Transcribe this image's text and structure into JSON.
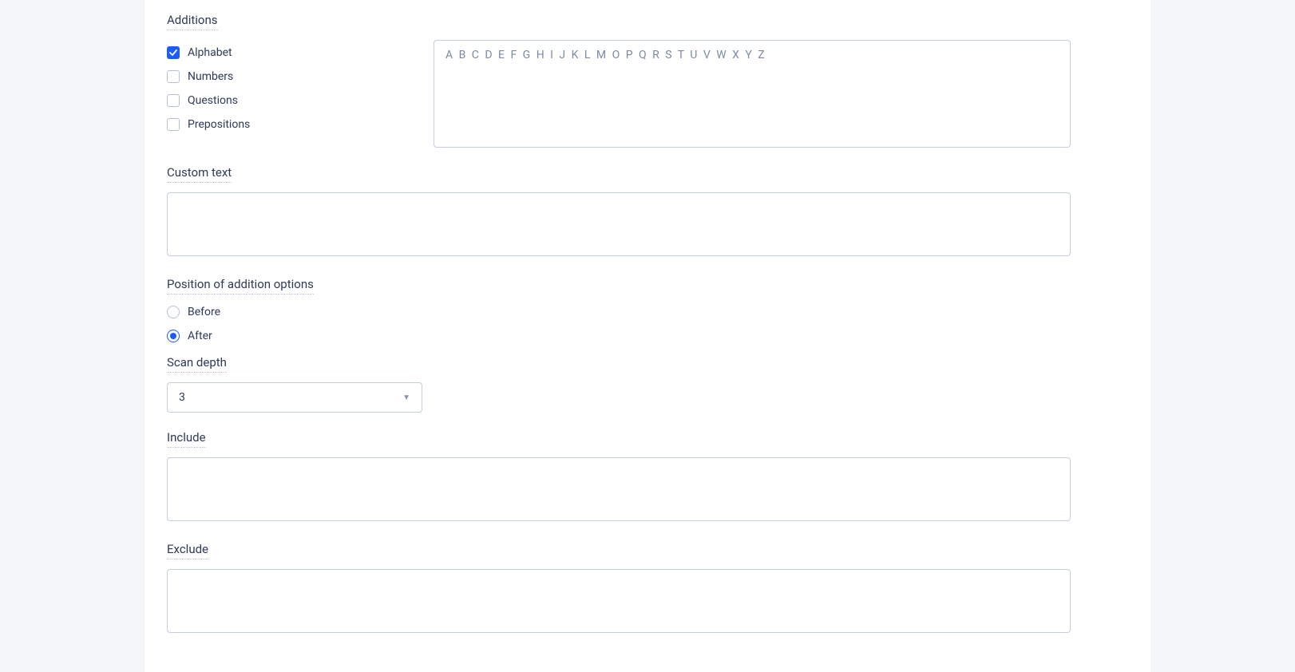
{
  "additions": {
    "title": "Additions",
    "options": [
      {
        "label": "Alphabet",
        "checked": true
      },
      {
        "label": "Numbers",
        "checked": false
      },
      {
        "label": "Questions",
        "checked": false
      },
      {
        "label": "Prepositions",
        "checked": false
      }
    ],
    "preview": "A B C D E F G H I J K L M O P Q R S T U V W X Y Z"
  },
  "customText": {
    "title": "Custom text",
    "value": ""
  },
  "position": {
    "title": "Position of addition options",
    "options": [
      {
        "label": "Before",
        "selected": false
      },
      {
        "label": "After",
        "selected": true
      }
    ]
  },
  "scanDepth": {
    "title": "Scan depth",
    "value": "3"
  },
  "include": {
    "title": "Include",
    "value": ""
  },
  "exclude": {
    "title": "Exclude",
    "value": ""
  }
}
